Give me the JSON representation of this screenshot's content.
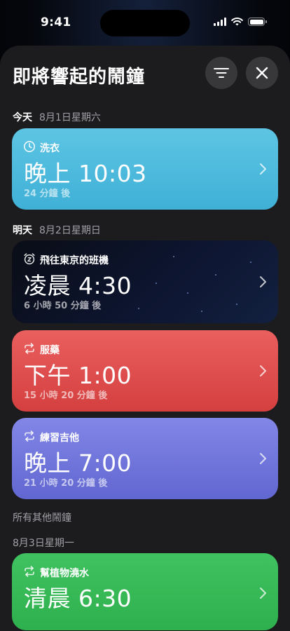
{
  "status_bar": {
    "time": "9:41"
  },
  "sheet": {
    "title": "即將響起的鬧鐘"
  },
  "sections": [
    {
      "day": "今天",
      "date": "8月1日星期六"
    },
    {
      "day": "明天",
      "date": "8月2日星期日"
    },
    {
      "day": "",
      "date": "所有其他鬧鐘"
    },
    {
      "day": "",
      "date": "8月3日星期一"
    }
  ],
  "alarms": [
    {
      "name": "洗衣",
      "time": "晚上 10:03",
      "relative": "24 分鐘 後",
      "icon": "clock-icon",
      "color": "#4cbadd"
    },
    {
      "name": "飛往東京的班機",
      "time": "凌晨 4:30",
      "relative": "6 小時 50 分鐘 後",
      "icon": "alarm-snooze-icon",
      "color": "#0c1326"
    },
    {
      "name": "服藥",
      "time": "下午 1:00",
      "relative": "15 小時 20 分鐘 後",
      "icon": "repeat-icon",
      "color": "#df4c4c"
    },
    {
      "name": "練習吉他",
      "time": "晚上 7:00",
      "relative": "21 小時 20 分鐘 後",
      "icon": "repeat-icon",
      "color": "#6f75dc"
    },
    {
      "name": "幫植物澆水",
      "time": "清晨 6:30",
      "relative": "",
      "icon": "repeat-icon",
      "color": "#36b955"
    }
  ]
}
